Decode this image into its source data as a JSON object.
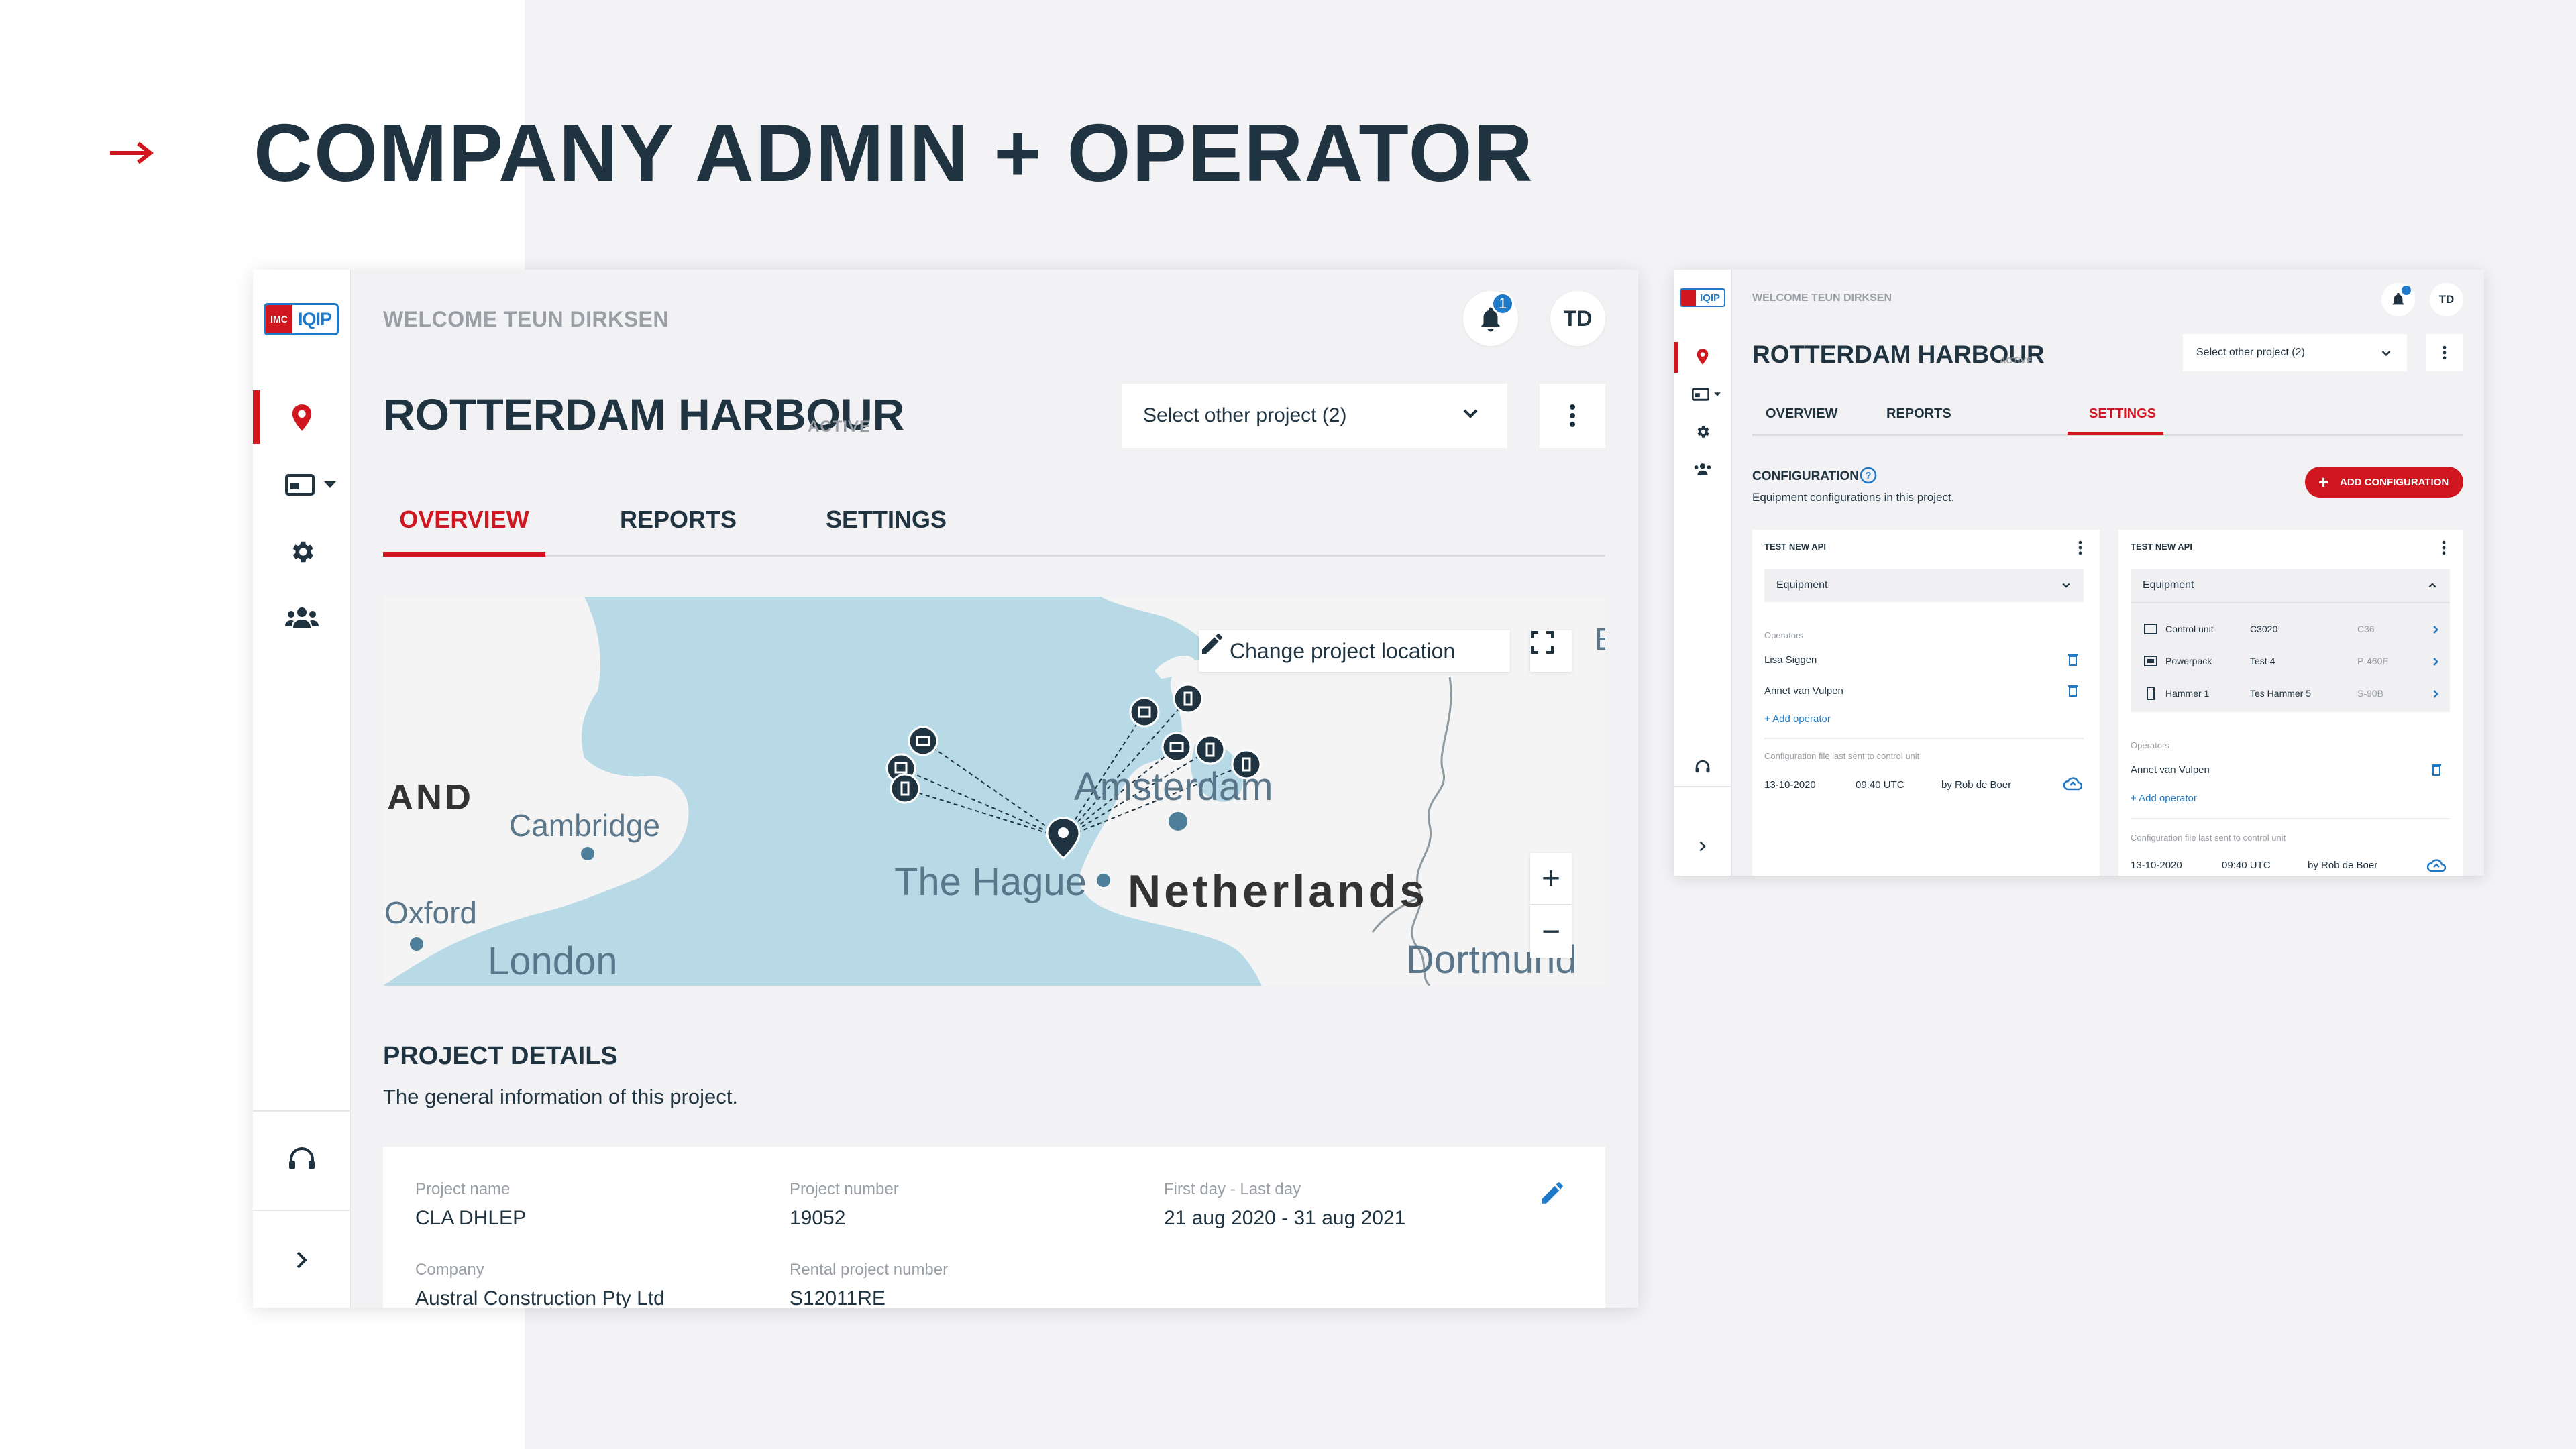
{
  "slide": {
    "title": "COMPANY ADMIN + OPERATOR"
  },
  "main": {
    "logo": {
      "left": "IMC",
      "right": "IQIP"
    },
    "welcome": "WELCOME TEUN DIRKSEN",
    "notification_count": "1",
    "user_initials": "TD",
    "project_title": "ROTTERDAM HARBOUR",
    "project_status": "ACTIVE",
    "select_project": "Select other project (2)",
    "tabs": [
      "OVERVIEW",
      "REPORTS",
      "SETTINGS"
    ],
    "active_tab": "OVERVIEW",
    "map": {
      "change_location": "Change project location",
      "labels": [
        "AND",
        "Cambridge",
        "Oxford",
        "London",
        "The Hague",
        "Amsterdam",
        "Netherlands",
        "Dortmund",
        "E"
      ],
      "zoom_in": "+",
      "zoom_out": "−"
    },
    "details": {
      "title": "PROJECT DETAILS",
      "subtitle": "The general information of this project.",
      "fields": [
        {
          "label": "Project name",
          "value": "CLA DHLEP"
        },
        {
          "label": "Project number",
          "value": "19052"
        },
        {
          "label": "First day - Last day",
          "value": "21 aug 2020 - 31 aug 2021"
        },
        {
          "label": "Company",
          "value": "Austral Construction Pty Ltd"
        },
        {
          "label": "Rental project number",
          "value": "S12011RE"
        }
      ]
    }
  },
  "settings_window": {
    "welcome": "WELCOME TEUN DIRKSEN",
    "user_initials": "TD",
    "project_title": "ROTTERDAM HARBOUR",
    "project_status": "ACTIVE",
    "select_project": "Select other project (2)",
    "tabs": [
      "OVERVIEW",
      "REPORTS",
      "SETTINGS"
    ],
    "active_tab": "SETTINGS",
    "configuration": {
      "title": "CONFIGURATION",
      "subtitle": "Equipment configurations in this project.",
      "add_button": "ADD CONFIGURATION",
      "cards": [
        {
          "name": "TEST NEW API",
          "dropdown": "Equipment",
          "operators_label": "Operators",
          "operators": [
            "Lisa Siggen",
            "Annet van Vulpen"
          ],
          "add_operator": "+ Add operator",
          "last_sent_label": "Configuration file last sent to control unit",
          "last_sent": {
            "date": "13-10-2020",
            "time": "09:40 UTC",
            "by": "by Rob de Boer"
          }
        },
        {
          "name": "TEST NEW API",
          "dropdown": "Equipment",
          "equipment": [
            {
              "type": "Control unit",
              "name": "C3020",
              "code": "C36"
            },
            {
              "type": "Powerpack",
              "name": "Test 4",
              "code": "P-460E"
            },
            {
              "type": "Hammer 1",
              "name": "Tes Hammer 5",
              "code": "S-90B"
            }
          ],
          "operators_label": "Operators",
          "operators": [
            "Annet van Vulpen"
          ],
          "add_operator": "+ Add operator",
          "last_sent_label": "Configuration file last sent to control unit",
          "last_sent": {
            "date": "13-10-2020",
            "time": "09:40 UTC",
            "by": "by Rob de Boer"
          }
        }
      ]
    }
  },
  "colors": {
    "accent_red": "#d0161f",
    "brand_blue": "#1e7ac8",
    "text_dark": "#1f3340",
    "water": "#b8d9e6"
  }
}
